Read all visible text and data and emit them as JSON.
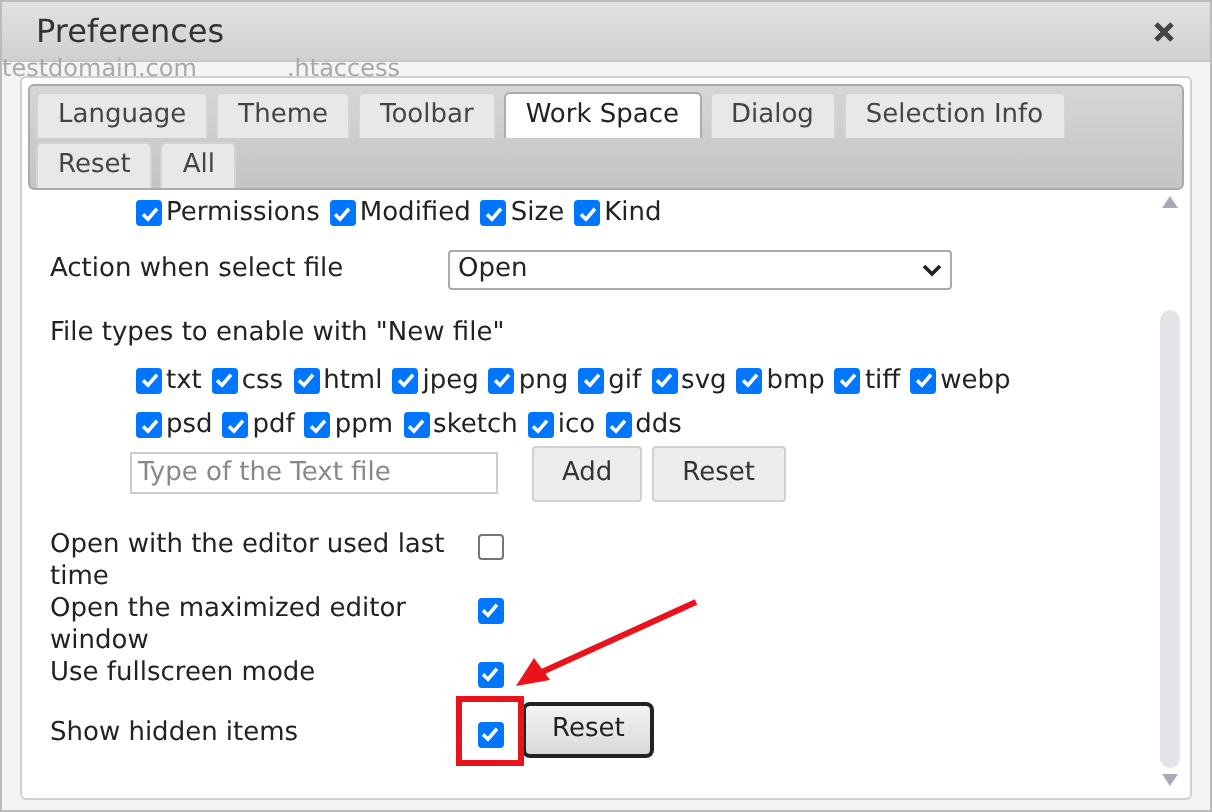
{
  "window": {
    "title": "Preferences"
  },
  "background_items": [
    "testdomain.com",
    ".htaccess"
  ],
  "tabs": [
    {
      "label": "Language",
      "selected": false
    },
    {
      "label": "Theme",
      "selected": false
    },
    {
      "label": "Toolbar",
      "selected": false
    },
    {
      "label": "Work Space",
      "selected": true
    },
    {
      "label": "Dialog",
      "selected": false
    },
    {
      "label": "Selection Info",
      "selected": false
    },
    {
      "label": "Reset",
      "selected": false
    },
    {
      "label": "All",
      "selected": false
    }
  ],
  "columns": [
    {
      "label": "Permissions",
      "checked": true
    },
    {
      "label": "Modified",
      "checked": true
    },
    {
      "label": "Size",
      "checked": true
    },
    {
      "label": "Kind",
      "checked": true
    }
  ],
  "action": {
    "label": "Action when select file",
    "value": "Open"
  },
  "file_types": {
    "label": "File types to enable with \"New file\"",
    "items": [
      {
        "label": "txt",
        "checked": true
      },
      {
        "label": "css",
        "checked": true
      },
      {
        "label": "html",
        "checked": true
      },
      {
        "label": "jpeg",
        "checked": true
      },
      {
        "label": "png",
        "checked": true
      },
      {
        "label": "gif",
        "checked": true
      },
      {
        "label": "svg",
        "checked": true
      },
      {
        "label": "bmp",
        "checked": true
      },
      {
        "label": "tiff",
        "checked": true
      },
      {
        "label": "webp",
        "checked": true
      },
      {
        "label": "psd",
        "checked": true
      },
      {
        "label": "pdf",
        "checked": true
      },
      {
        "label": "ppm",
        "checked": true
      },
      {
        "label": "sketch",
        "checked": true
      },
      {
        "label": "ico",
        "checked": true
      },
      {
        "label": "dds",
        "checked": true
      }
    ],
    "input": {
      "placeholder": "Type of the Text file"
    },
    "buttons": [
      "Add",
      "Reset"
    ]
  },
  "options": [
    {
      "label": "Open with the editor used last time",
      "checked": false
    },
    {
      "label": "Open the maximized editor window",
      "checked": true
    },
    {
      "label": "Use fullscreen mode",
      "checked": true
    },
    {
      "label": "Show hidden items",
      "checked": true,
      "reset_button": "Reset",
      "annotated": true
    }
  ]
}
